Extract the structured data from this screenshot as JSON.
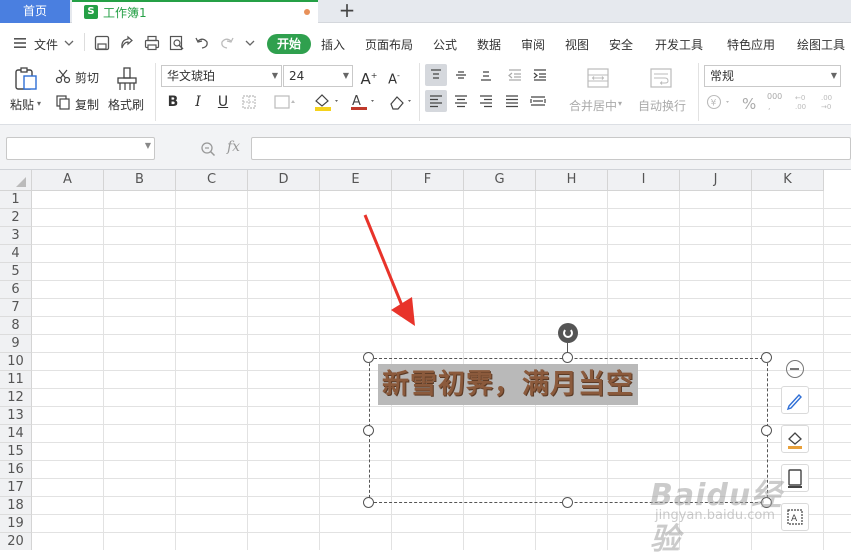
{
  "tabs": {
    "home_label": "首页",
    "doc_icon_letter": "S",
    "doc_title": "工作簿1",
    "add_label": "+"
  },
  "menu": {
    "file_label": "文件",
    "items": [
      "开始",
      "插入",
      "页面布局",
      "公式",
      "数据",
      "审阅",
      "视图",
      "安全",
      "开发工具",
      "特色应用",
      "绘图工具"
    ]
  },
  "ribbon": {
    "paste_label": "粘贴",
    "cut_label": "剪切",
    "copy_label": "复制",
    "format_painter_label": "格式刷",
    "font_name": "华文琥珀",
    "font_size": "24",
    "merge_label": "合并居中",
    "wrap_label": "自动换行",
    "number_format": "常规",
    "bold": "B",
    "italic": "I",
    "underline": "U",
    "percent": "%",
    "thousands": "000"
  },
  "formula_bar": {
    "fx_label": "fx"
  },
  "sheet": {
    "columns": [
      "A",
      "B",
      "C",
      "D",
      "E",
      "F",
      "G",
      "H",
      "I",
      "J",
      "K"
    ],
    "rows": [
      "1",
      "2",
      "3",
      "4",
      "5",
      "6",
      "7",
      "8",
      "9",
      "10",
      "11",
      "12",
      "13",
      "14",
      "15",
      "16",
      "17",
      "18",
      "19",
      "20"
    ]
  },
  "textbox": {
    "text": "新雪初霁，满月当空"
  },
  "watermark": {
    "brand": "Baidu经验",
    "url": "jingyan.baidu.com"
  },
  "colors": {
    "accent_green": "#2fa04e",
    "home_tab": "#4a7fe0",
    "arrow_red": "#e8332a",
    "text_brown": "#8b5a3c"
  },
  "icons": [
    "menu-icon",
    "save-icon",
    "undo-icon",
    "redo-icon",
    "print-icon",
    "preview-icon",
    "pen-icon",
    "fill-icon",
    "border-icon",
    "rotate-icon"
  ]
}
